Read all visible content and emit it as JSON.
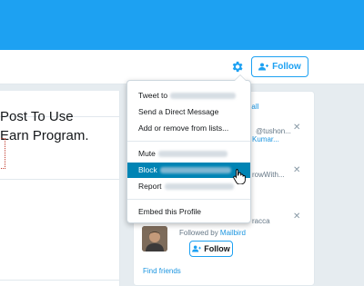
{
  "header": {
    "follow_label": "Follow"
  },
  "main": {
    "tweet_line1": "Post To Use",
    "tweet_line2": "Earn Program."
  },
  "dropdown": {
    "items": [
      {
        "label": "Tweet to"
      },
      {
        "label": "Send a Direct Message"
      },
      {
        "label": "Add or remove from lists..."
      },
      {
        "label": "Mute"
      },
      {
        "label": "Block"
      },
      {
        "label": "Report"
      },
      {
        "label": "Embed this Profile"
      }
    ]
  },
  "sidebar": {
    "view_all": "View all",
    "s1_handle": "@tushon...",
    "s1_name": "Kumar...",
    "s2_text": "rowWith...",
    "s3_text": "racca",
    "followed_by_prefix": "Followed by",
    "followed_by_name": "Mailbird",
    "follow_label": "Follow",
    "find_friends": "Find friends"
  },
  "colors": {
    "accent": "#1da1f2",
    "menu_highlight": "#0084b4",
    "link": "#1b95e0"
  }
}
